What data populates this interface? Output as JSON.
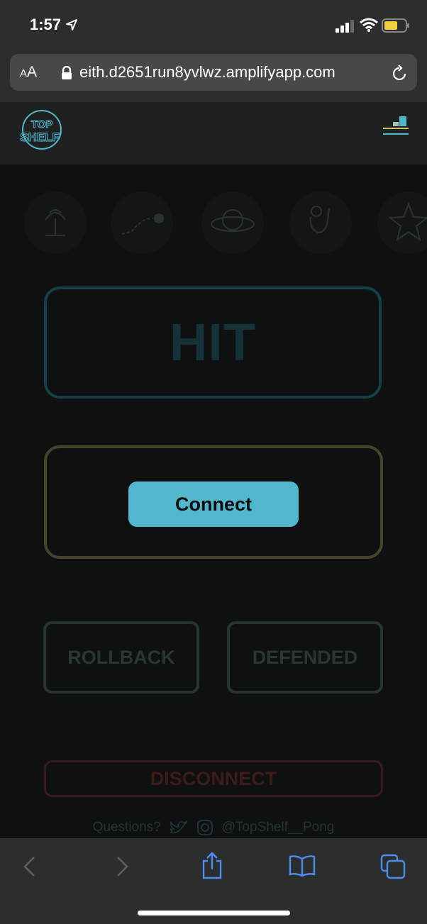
{
  "status_bar": {
    "time": "1:57",
    "icons": [
      "location-arrow-icon",
      "signal-icon",
      "wifi-icon",
      "battery-icon"
    ]
  },
  "browser": {
    "text_size_label_small": "A",
    "text_size_label_large": "A",
    "url": "eith.d2651run8yvlwz.amplifyapp.com"
  },
  "app": {
    "logo_text_top": "TOP",
    "logo_text_bottom": "SHELF",
    "icon_row": [
      "palm-tree-icon",
      "ball-bounce-icon",
      "planet-icon",
      "hand-ok-icon",
      "star-icon"
    ],
    "hit_label": "HIT",
    "connect_label": "Connect",
    "rollback_label": "ROLLBACK",
    "defended_label": "DEFENDED",
    "disconnect_label": "DISCONNECT",
    "footer": {
      "questions": "Questions?",
      "handle": "@TopShelf__Pong"
    }
  },
  "toolbar": {
    "icons": [
      "back-icon",
      "forward-icon",
      "share-icon",
      "bookmarks-icon",
      "tabs-icon"
    ]
  },
  "colors": {
    "accent": "#52b6cd",
    "background": "#0f1010"
  }
}
